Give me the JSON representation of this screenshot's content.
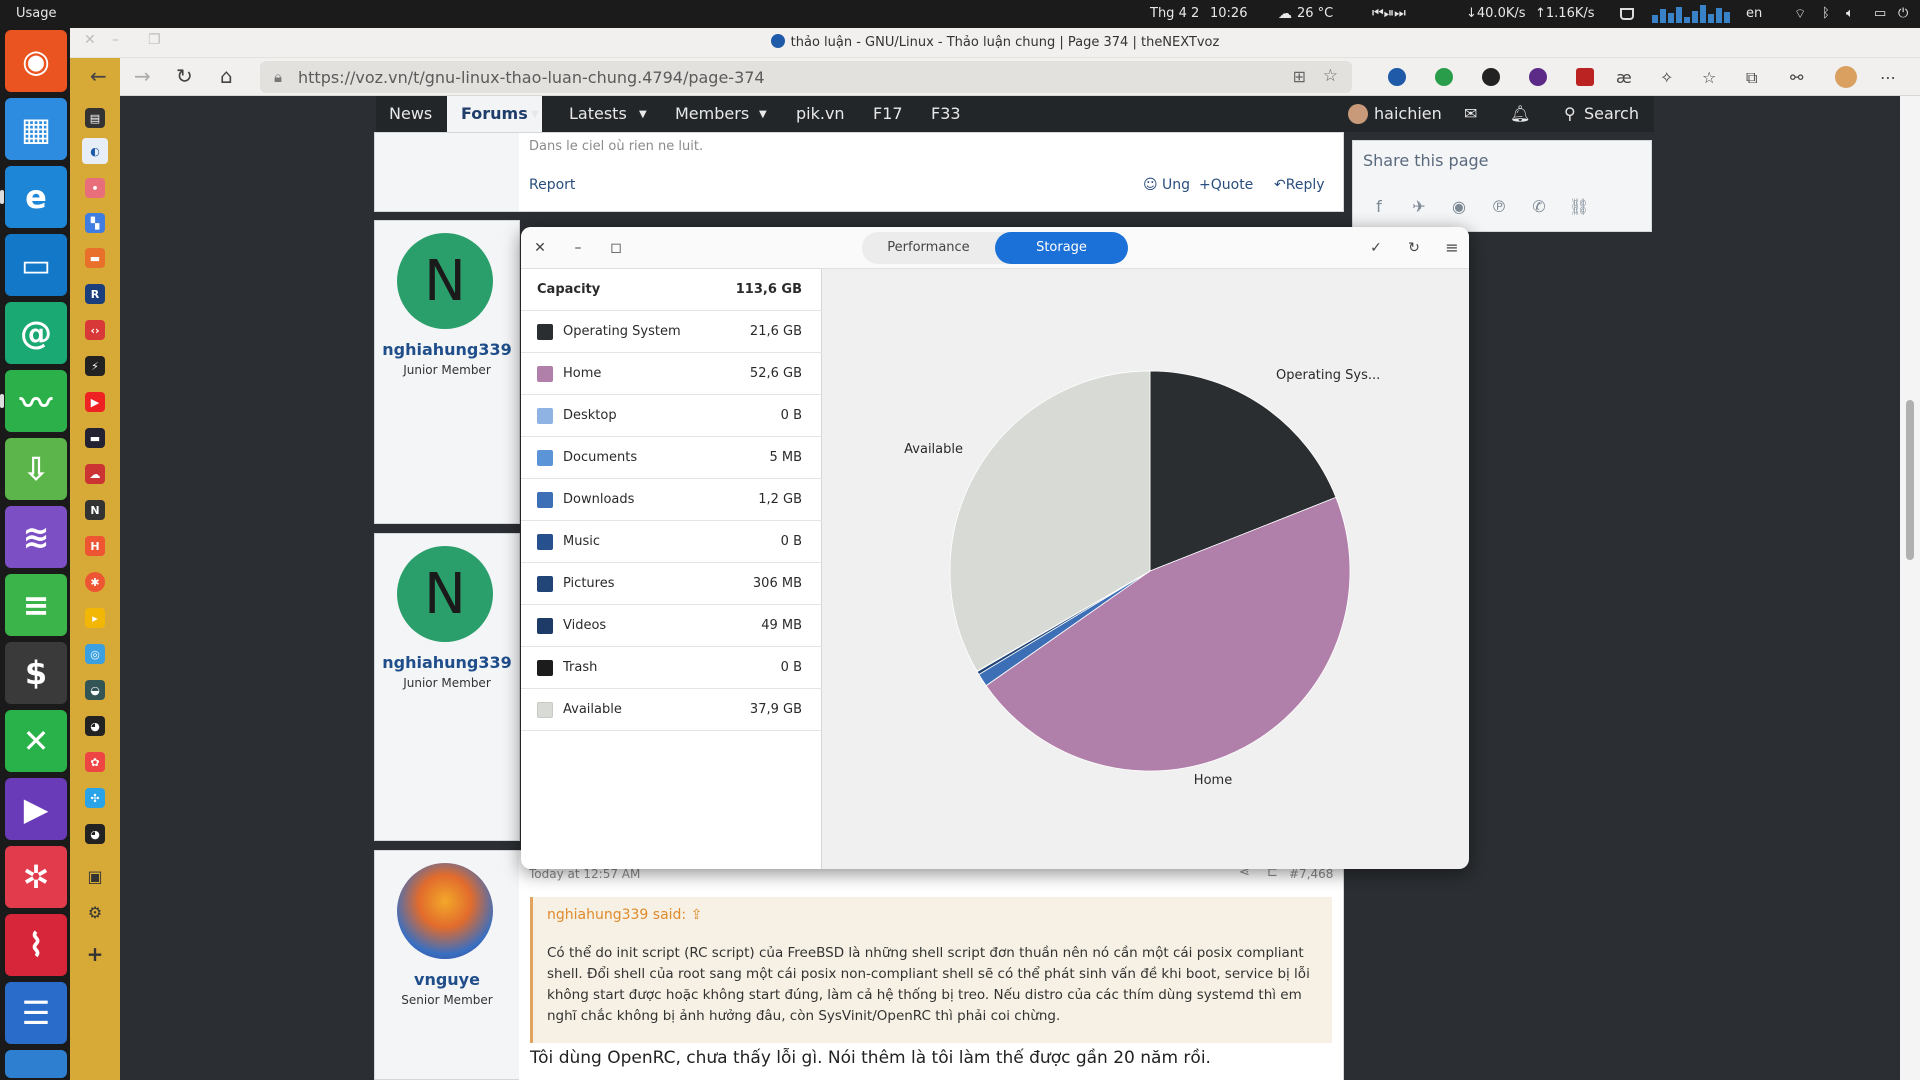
{
  "top_panel": {
    "activities": "Usage",
    "date": "Thg 4 2",
    "time": "10:26",
    "weather": "26 °C",
    "media": "⏮⏯⏭",
    "net_down": "↓40.0K/s",
    "net_up": "↑1.16K/s",
    "lang": "en"
  },
  "browser": {
    "tab_title": "thảo luận - GNU/Linux - Thảo luận chung | Page 374 | theNEXTvoz",
    "url": "https://voz.vn/t/gnu-linux-thao-luan-chung.4794/page-374",
    "url_domain": "voz.vn"
  },
  "site_nav": {
    "items": [
      "News",
      "Forums",
      "Latests",
      "Members",
      "pik.vn",
      "F17",
      "F33"
    ],
    "username": "haichien",
    "search": "Search"
  },
  "prev_post": {
    "text": "Dans le ciel où rien ne luit.",
    "report": "Report",
    "ung": "Ung",
    "quote": "+Quote",
    "reply": "Reply"
  },
  "share": {
    "title": "Share this page"
  },
  "posts": [
    {
      "avatar_letter": "N",
      "username": "nghiahung339",
      "role": "Junior Member"
    },
    {
      "avatar_letter": "N",
      "username": "nghiahung339",
      "role": "Junior Member"
    },
    {
      "username": "vnguye",
      "role": "Senior Member",
      "timestamp": "Today at 12:57 AM",
      "post_no": "#7,468",
      "quote_author": "nghiahung339 said:",
      "quote_text": "Có thể do init script (RC script) của FreeBSD là những shell script đơn thuần nên nó cần một cái posix compliant shell. Đổi shell của root sang một cái posix non-compliant shell sẽ có thể phát sinh vấn đề khi boot, service bị lỗi không start được hoặc không start đúng, làm cả hệ thống bị treo. Nếu distro của các thím dùng systemd thì em nghĩ chắc không bị ảnh hưởng đâu, còn SysVinit/OpenRC thì phải coi chừng.",
      "body": "Tôi dùng OpenRC, chưa thấy lỗi gì. Nói thêm là tôi làm thế được gần 20 năm rồi."
    }
  ],
  "usage_app": {
    "tabs": [
      "Performance",
      "Storage"
    ],
    "active_tab": "Storage",
    "capacity_label": "Capacity",
    "capacity_value": "113,6 GB",
    "rows": [
      {
        "label": "Operating System",
        "value": "21,6 GB",
        "color": "#2a2e31"
      },
      {
        "label": "Home",
        "value": "52,6 GB",
        "color": "#b07faa"
      },
      {
        "label": "Desktop",
        "value": "0 B",
        "color": "#8fb4e3"
      },
      {
        "label": "Documents",
        "value": "5 MB",
        "color": "#5b95d8"
      },
      {
        "label": "Downloads",
        "value": "1,2 GB",
        "color": "#3d6fb6"
      },
      {
        "label": "Music",
        "value": "0 B",
        "color": "#27508f"
      },
      {
        "label": "Pictures",
        "value": "306 MB",
        "color": "#224578"
      },
      {
        "label": "Videos",
        "value": "49 MB",
        "color": "#1e3a66"
      },
      {
        "label": "Trash",
        "value": "0 B",
        "color": "#1c1c1c"
      },
      {
        "label": "Available",
        "value": "37,9 GB",
        "color": "#d8dbd5"
      }
    ],
    "pie_labels": {
      "os": "Operating Sys...",
      "home": "Home",
      "available": "Available"
    }
  },
  "chart_data": {
    "type": "pie",
    "categories": [
      "Operating System",
      "Home",
      "Desktop",
      "Documents",
      "Downloads",
      "Music",
      "Pictures",
      "Videos",
      "Trash",
      "Available"
    ],
    "values": [
      21.6,
      52.6,
      0,
      0.005,
      1.2,
      0,
      0.306,
      0.049,
      0,
      37.9
    ],
    "colors": [
      "#2a2e31",
      "#b07faa",
      "#8fb4e3",
      "#5b95d8",
      "#3d6fb6",
      "#27508f",
      "#224578",
      "#1e3a66",
      "#1c1c1c",
      "#d8dbd5"
    ]
  }
}
